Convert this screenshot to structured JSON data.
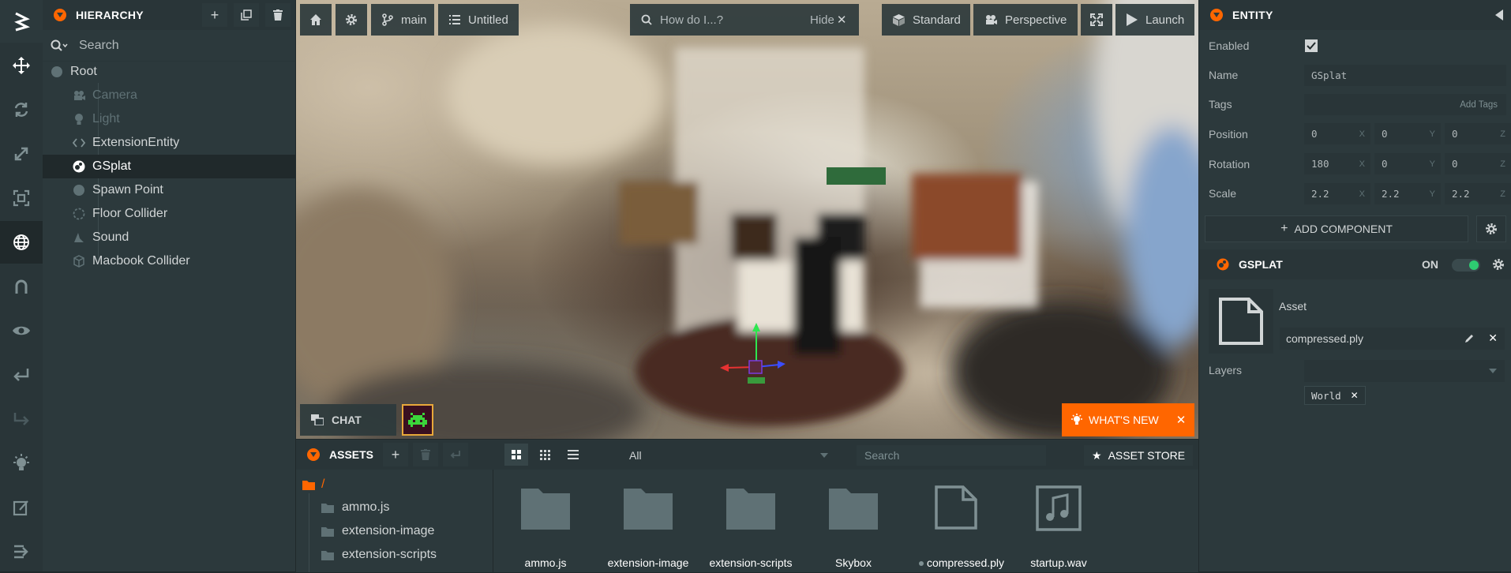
{
  "colors": {
    "accent": "#ff6600",
    "panel": "#2c393c",
    "dark": "#20292b",
    "toggle_on": "#2ecc71"
  },
  "hierarchy": {
    "title": "HIERARCHY",
    "search_placeholder": "Search",
    "items": [
      {
        "label": "Root",
        "icon": "circle-icon"
      },
      {
        "label": "Camera",
        "icon": "camera-icon"
      },
      {
        "label": "Light",
        "icon": "lightbulb-icon"
      },
      {
        "label": "ExtensionEntity",
        "icon": "code-icon"
      },
      {
        "label": "GSplat",
        "icon": "gsplat-icon"
      },
      {
        "label": "Spawn Point",
        "icon": "circle-icon"
      },
      {
        "label": "Floor Collider",
        "icon": "collision-icon"
      },
      {
        "label": "Sound",
        "icon": "sound-icon"
      },
      {
        "label": "Macbook Collider",
        "icon": "cube-icon"
      }
    ]
  },
  "viewport": {
    "branch": "main",
    "scene": "Untitled",
    "help_placeholder": "How do I...?",
    "hide_label": "Hide",
    "render_mode": "Standard",
    "camera": "Perspective",
    "launch": "Launch",
    "chat": "CHAT",
    "whats_new": "WHAT'S NEW"
  },
  "entity": {
    "title": "ENTITY",
    "enabled_label": "Enabled",
    "name_label": "Name",
    "name_value": "GSplat",
    "tags_label": "Tags",
    "add_tags": "Add Tags",
    "position_label": "Position",
    "position": [
      "0",
      "0",
      "0"
    ],
    "rotation_label": "Rotation",
    "rotation": [
      "180",
      "0",
      "0"
    ],
    "scale_label": "Scale",
    "scale": [
      "2.2",
      "2.2",
      "2.2"
    ],
    "axes": [
      "X",
      "Y",
      "Z"
    ],
    "add_component": "ADD COMPONENT",
    "component": {
      "title": "GSPLAT",
      "state": "ON",
      "asset_label": "Asset",
      "asset_value": "compressed.ply",
      "layers_label": "Layers",
      "layer_tag": "World"
    }
  },
  "assets": {
    "title": "ASSETS",
    "filter": "All",
    "search_placeholder": "Search",
    "store": "ASSET STORE",
    "root": "/",
    "folders": [
      "ammo.js",
      "extension-image",
      "extension-scripts"
    ],
    "items": [
      {
        "label": "ammo.js",
        "type": "folder"
      },
      {
        "label": "extension-image",
        "type": "folder"
      },
      {
        "label": "extension-scripts",
        "type": "folder"
      },
      {
        "label": "Skybox",
        "type": "folder"
      },
      {
        "label": "compressed.ply",
        "type": "file"
      },
      {
        "label": "startup.wav",
        "type": "audio"
      }
    ]
  }
}
